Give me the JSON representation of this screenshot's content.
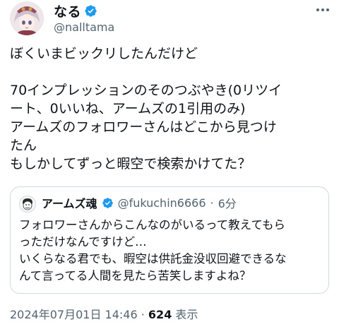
{
  "author": {
    "display_name": "なる",
    "handle": "@nalltama"
  },
  "tweet": {
    "text": "ぼくいまビックリしたんだけど\n\n70インプレッションのそのつぶやき(0リツイ\nート、0いいね、アームズの1引用のみ)\nアームズのフォロワーさんはどこから見つけ\nたん\nもしかしてずっと暇空で検索かけてた？"
  },
  "quote": {
    "display_name": "アームズ魂",
    "handle": "@fukuchin6666",
    "separator": "·",
    "time": "6分",
    "text": "フォロワーさんからこんなのがいるって教えてもら\nっただけなんですけど…\nいくらなる君でも、暇空は供託金没収回避できるな\nんて言ってる人間を見たら苦笑しますよね？"
  },
  "meta": {
    "datetime": "2024年07月01日 14:46",
    "separator": "·",
    "views": "624",
    "views_label": "表示"
  },
  "colors": {
    "verified": "#1d9bf0",
    "secondary_text": "#536471",
    "border": "#cfd9de"
  },
  "icons": [
    "more-icon",
    "verified-badge-icon"
  ]
}
